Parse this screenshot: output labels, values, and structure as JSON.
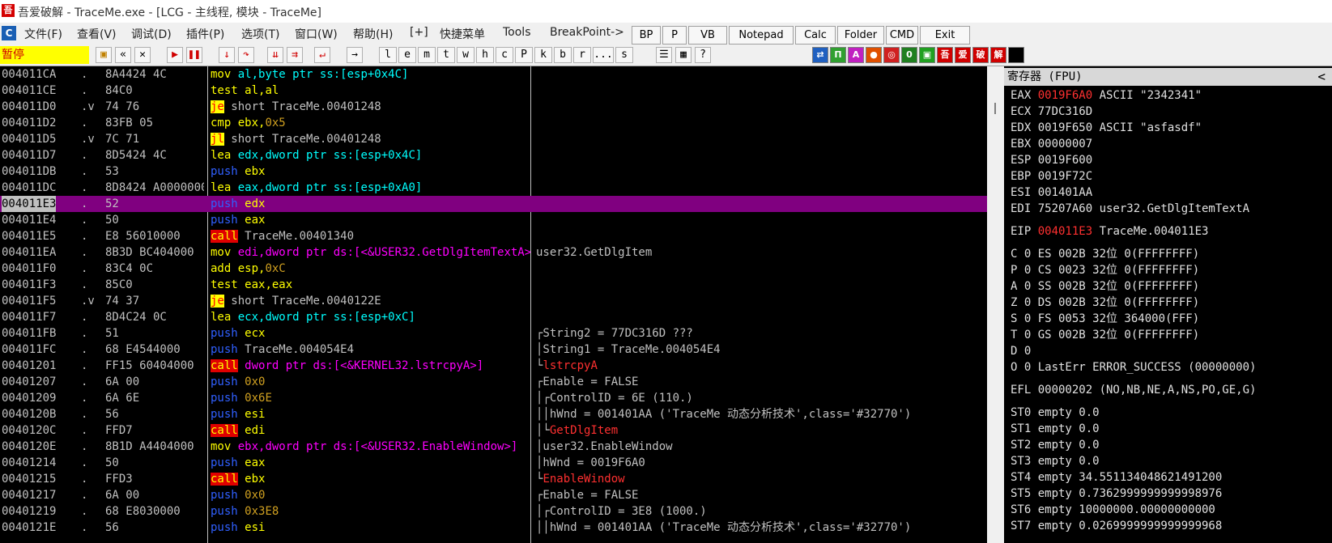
{
  "window": {
    "title": "吾爱破解 - TraceMe.exe - [LCG - 主线程, 模块 - TraceMe]",
    "app_icon": "吾"
  },
  "menu": {
    "icon": "C",
    "items": [
      "文件(F)",
      "查看(V)",
      "调试(D)",
      "插件(P)",
      "选项(T)",
      "窗口(W)",
      "帮助(H)",
      "[+]",
      "快捷菜单",
      "Tools",
      "BreakPoint->"
    ],
    "buttons": [
      "BP",
      "P",
      "VB",
      "Notepad",
      "Calc",
      "Folder",
      "CMD",
      "Exit"
    ]
  },
  "toolbar": {
    "status": "暂停",
    "letters": [
      "l",
      "e",
      "m",
      "t",
      "w",
      "h",
      "c",
      "P",
      "k",
      "b",
      "r",
      "...",
      "s"
    ],
    "icons": [
      "open-icon",
      "restart-icon",
      "close-icon",
      "run-icon",
      "pause-icon",
      "step-into-icon",
      "step-over-icon",
      "trace-into-icon",
      "trace-over-icon",
      "execute-till-return-icon",
      "goto-icon"
    ],
    "plugin_icons": [
      "吾",
      "爱",
      "破",
      "解"
    ]
  },
  "disasm": [
    {
      "addr": "004011CA",
      "mark": ".",
      "hex": "8A4424 4C",
      "mn": "mov",
      "mc": "y",
      "ops": [
        [
          "al,byte ptr ss:[esp+0x4C]",
          "c"
        ]
      ],
      "com": ""
    },
    {
      "addr": "004011CE",
      "mark": ".",
      "hex": "84C0",
      "mn": "test",
      "mc": "y",
      "ops": [
        [
          "al,al",
          "y"
        ]
      ],
      "com": ""
    },
    {
      "addr": "004011D0",
      "mark": ".v",
      "hex": "74 76",
      "mn": "je",
      "mc": "j",
      "ops": [
        [
          "short TraceMe.00401248",
          "op"
        ]
      ],
      "com": ""
    },
    {
      "addr": "004011D2",
      "mark": ".",
      "hex": "83FB 05",
      "mn": "cmp",
      "mc": "y",
      "ops": [
        [
          "ebx,",
          "y"
        ],
        [
          "0x5",
          "n"
        ]
      ],
      "com": ""
    },
    {
      "addr": "004011D5",
      "mark": ".v",
      "hex": "7C 71",
      "mn": "jl",
      "mc": "j",
      "ops": [
        [
          "short TraceMe.00401248",
          "op"
        ]
      ],
      "com": ""
    },
    {
      "addr": "004011D7",
      "mark": ".",
      "hex": "8D5424 4C",
      "mn": "lea",
      "mc": "y",
      "ops": [
        [
          "edx,dword ptr ss:[esp+0x4C]",
          "c"
        ]
      ],
      "com": ""
    },
    {
      "addr": "004011DB",
      "mark": ".",
      "hex": "53",
      "mn": "push",
      "mc": "b",
      "ops": [
        [
          "ebx",
          "y"
        ]
      ],
      "com": ""
    },
    {
      "addr": "004011DC",
      "mark": ".",
      "hex": "8D8424 A0000000",
      "mn": "lea",
      "mc": "y",
      "ops": [
        [
          "eax,dword ptr ss:[esp+0xA0]",
          "c"
        ]
      ],
      "com": ""
    },
    {
      "addr": "004011E3",
      "mark": ".",
      "hex": "52",
      "mn": "push",
      "mc": "b",
      "ops": [
        [
          "edx",
          "y"
        ]
      ],
      "com": "",
      "sel": true
    },
    {
      "addr": "004011E4",
      "mark": ".",
      "hex": "50",
      "mn": "push",
      "mc": "b",
      "ops": [
        [
          "eax",
          "y"
        ]
      ],
      "com": ""
    },
    {
      "addr": "004011E5",
      "mark": ".",
      "hex": "E8 56010000",
      "mn": "call",
      "mc": "r",
      "ops": [
        [
          "TraceMe.00401340",
          "op"
        ]
      ],
      "com": ""
    },
    {
      "addr": "004011EA",
      "mark": ".",
      "hex": "8B3D BC404000",
      "mn": "mov",
      "mc": "y",
      "ops": [
        [
          "edi,dword ptr ds:[<&USER32.GetDlgItemTextA>]",
          "m"
        ]
      ],
      "com": "user32.GetDlgItem"
    },
    {
      "addr": "004011F0",
      "mark": ".",
      "hex": "83C4 0C",
      "mn": "add",
      "mc": "y",
      "ops": [
        [
          "esp,",
          "y"
        ],
        [
          "0xC",
          "n"
        ]
      ],
      "com": ""
    },
    {
      "addr": "004011F3",
      "mark": ".",
      "hex": "85C0",
      "mn": "test",
      "mc": "y",
      "ops": [
        [
          "eax,eax",
          "y"
        ]
      ],
      "com": ""
    },
    {
      "addr": "004011F5",
      "mark": ".v",
      "hex": "74 37",
      "mn": "je",
      "mc": "j",
      "ops": [
        [
          "short TraceMe.0040122E",
          "op"
        ]
      ],
      "com": ""
    },
    {
      "addr": "004011F7",
      "mark": ".",
      "hex": "8D4C24 0C",
      "mn": "lea",
      "mc": "y",
      "ops": [
        [
          "ecx,dword ptr ss:[esp+0xC]",
          "c"
        ]
      ],
      "com": ""
    },
    {
      "addr": "004011FB",
      "mark": ".",
      "hex": "51",
      "mn": "push",
      "mc": "b",
      "ops": [
        [
          "ecx",
          "y"
        ]
      ],
      "com": "┌String2 = 77DC316D ???"
    },
    {
      "addr": "004011FC",
      "mark": ".",
      "hex": "68 E4544000",
      "mn": "push",
      "mc": "b",
      "ops": [
        [
          "TraceMe.004054E4",
          "op"
        ]
      ],
      "com": "│String1 = TraceMe.004054E4"
    },
    {
      "addr": "00401201",
      "mark": ".",
      "hex": "FF15 60404000",
      "mn": "call",
      "mc": "r",
      "ops": [
        [
          "dword ptr ds:[<&KERNEL32.lstrcpyA>]",
          "m"
        ]
      ],
      "com": "└lstrcpyA",
      "comred": true
    },
    {
      "addr": "00401207",
      "mark": ".",
      "hex": "6A 00",
      "mn": "push",
      "mc": "b",
      "ops": [
        [
          "0x0",
          "n"
        ]
      ],
      "com": "┌Enable = FALSE"
    },
    {
      "addr": "00401209",
      "mark": ".",
      "hex": "6A 6E",
      "mn": "push",
      "mc": "b",
      "ops": [
        [
          "0x6E",
          "n"
        ]
      ],
      "com": "│┌ControlID = 6E (110.)"
    },
    {
      "addr": "0040120B",
      "mark": ".",
      "hex": "56",
      "mn": "push",
      "mc": "b",
      "ops": [
        [
          "esi",
          "y"
        ]
      ],
      "com": "││hWnd = 001401AA ('TraceMe 动态分析技术',class='#32770')"
    },
    {
      "addr": "0040120C",
      "mark": ".",
      "hex": "FFD7",
      "mn": "call",
      "mc": "r",
      "ops": [
        [
          "edi",
          "y"
        ]
      ],
      "com": "│└GetDlgItem",
      "comred": true
    },
    {
      "addr": "0040120E",
      "mark": ".",
      "hex": "8B1D A4404000",
      "mn": "mov",
      "mc": "y",
      "ops": [
        [
          "ebx,dword ptr ds:[<&USER32.EnableWindow>]",
          "m"
        ]
      ],
      "com": "│user32.EnableWindow"
    },
    {
      "addr": "00401214",
      "mark": ".",
      "hex": "50",
      "mn": "push",
      "mc": "b",
      "ops": [
        [
          "eax",
          "y"
        ]
      ],
      "com": "│hWnd = 0019F6A0"
    },
    {
      "addr": "00401215",
      "mark": ".",
      "hex": "FFD3",
      "mn": "call",
      "mc": "r",
      "ops": [
        [
          "ebx",
          "y"
        ]
      ],
      "com": "└EnableWindow",
      "comred": true
    },
    {
      "addr": "00401217",
      "mark": ".",
      "hex": "6A 00",
      "mn": "push",
      "mc": "b",
      "ops": [
        [
          "0x0",
          "n"
        ]
      ],
      "com": "┌Enable = FALSE"
    },
    {
      "addr": "00401219",
      "mark": ".",
      "hex": "68 E8030000",
      "mn": "push",
      "mc": "b",
      "ops": [
        [
          "0x3E8",
          "n"
        ]
      ],
      "com": "│┌ControlID = 3E8 (1000.)"
    },
    {
      "addr": "0040121E",
      "mark": ".",
      "hex": "56",
      "mn": "push",
      "mc": "b",
      "ops": [
        [
          "esi",
          "y"
        ]
      ],
      "com": "││hWnd = 001401AA ('TraceMe 动态分析技术',class='#32770')"
    }
  ],
  "registers": {
    "header": "寄存器 (FPU)",
    "collapse": "<",
    "lines": [
      {
        "t": "EAX ",
        "v": "0019F6A0",
        "red": true,
        "r": " ASCII \"2342341\""
      },
      {
        "t": "ECX 77DC316D",
        "v": "",
        "r": ""
      },
      {
        "t": "EDX 0019F650 ASCII \"asfasdf\"",
        "v": "",
        "r": ""
      },
      {
        "t": "EBX 00000007",
        "v": "",
        "r": ""
      },
      {
        "t": "ESP 0019F600",
        "v": "",
        "r": ""
      },
      {
        "t": "EBP 0019F72C",
        "v": "",
        "r": ""
      },
      {
        "t": "ESI 001401AA",
        "v": "",
        "r": ""
      },
      {
        "t": "EDI 75207A60 user32.GetDlgItemTextA",
        "v": "",
        "r": ""
      },
      {
        "t": "",
        "v": "",
        "r": ""
      },
      {
        "t": "EIP ",
        "v": "004011E3",
        "red": true,
        "r": " TraceMe.004011E3"
      },
      {
        "t": "",
        "v": "",
        "r": ""
      },
      {
        "t": "C 0  ES 002B 32位 0(FFFFFFFF)",
        "v": "",
        "r": ""
      },
      {
        "t": "P 0  CS 0023 32位 0(FFFFFFFF)",
        "v": "",
        "r": ""
      },
      {
        "t": "A 0  SS 002B 32位 0(FFFFFFFF)",
        "v": "",
        "r": ""
      },
      {
        "t": "Z 0  DS 002B 32位 0(FFFFFFFF)",
        "v": "",
        "r": ""
      },
      {
        "t": "S 0  FS 0053 32位 364000(FFF)",
        "v": "",
        "r": ""
      },
      {
        "t": "T 0  GS 002B 32位 0(FFFFFFFF)",
        "v": "",
        "r": ""
      },
      {
        "t": "D 0",
        "v": "",
        "r": ""
      },
      {
        "t": "O 0  LastErr ERROR_SUCCESS (00000000)",
        "v": "",
        "r": ""
      },
      {
        "t": "",
        "v": "",
        "r": ""
      },
      {
        "t": "EFL 00000202 (NO,NB,NE,A,NS,PO,GE,G)",
        "v": "",
        "r": ""
      },
      {
        "t": "",
        "v": "",
        "r": ""
      },
      {
        "t": "ST0 empty 0.0",
        "v": "",
        "r": ""
      },
      {
        "t": "ST1 empty 0.0",
        "v": "",
        "r": ""
      },
      {
        "t": "ST2 empty 0.0",
        "v": "",
        "r": ""
      },
      {
        "t": "ST3 empty 0.0",
        "v": "",
        "r": ""
      },
      {
        "t": "ST4 empty 34.551134048621491200",
        "v": "",
        "r": ""
      },
      {
        "t": "ST5 empty 0.7362999999999998976",
        "v": "",
        "r": ""
      },
      {
        "t": "ST6 empty 10000000.00000000000",
        "v": "",
        "r": ""
      },
      {
        "t": "ST7 empty 0.0269999999999999968",
        "v": "",
        "r": ""
      }
    ]
  },
  "colors": {
    "code_bg": "#000000",
    "selection": "#800080",
    "mnemonic_push": "#3060ff",
    "mnemonic_call_bg": "#e00000",
    "jump_bg": "#ffff00",
    "status_bg": "#ffff00"
  }
}
